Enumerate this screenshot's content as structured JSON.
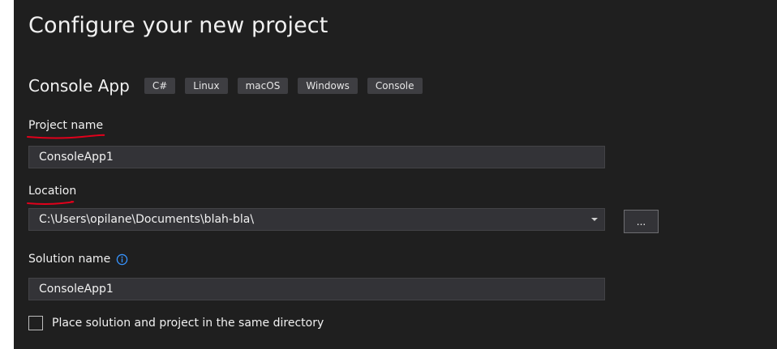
{
  "page": {
    "title": "Configure your new project"
  },
  "template": {
    "name": "Console App",
    "tags": [
      "C#",
      "Linux",
      "macOS",
      "Windows",
      "Console"
    ]
  },
  "project_name": {
    "label": "Project name",
    "value": "ConsoleApp1"
  },
  "location": {
    "label": "Location",
    "value": "C:\\Users\\opilane\\Documents\\blah-bla\\",
    "browse_label": "..."
  },
  "solution_name": {
    "label": "Solution name",
    "value": "ConsoleApp1",
    "info_icon": "info-icon"
  },
  "same_directory": {
    "label": "Place solution and project in the same directory",
    "checked": false
  },
  "colors": {
    "background": "#1f1f1f",
    "input_background": "#333337",
    "tag_background": "#3e3e42",
    "annotation_red": "#e0001b",
    "info_blue": "#3794ff"
  }
}
